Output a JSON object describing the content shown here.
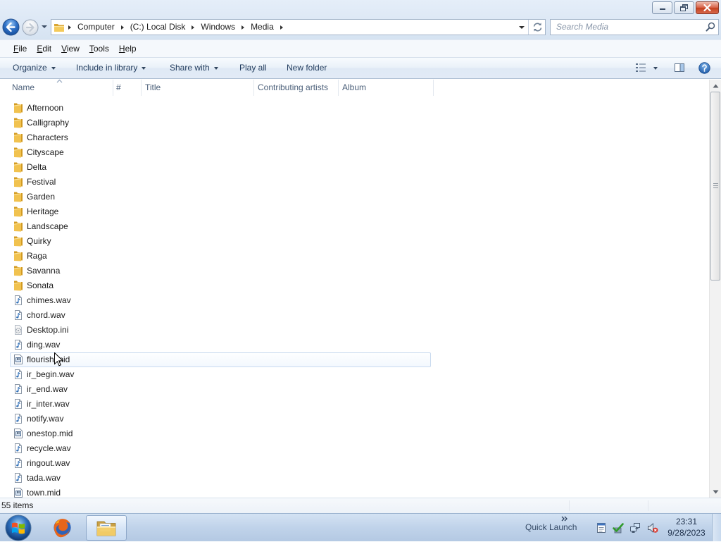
{
  "navigation": {
    "crumbs": [
      "Computer",
      "(C:) Local Disk",
      "Windows",
      "Media"
    ],
    "search_placeholder": "Search Media"
  },
  "menu": [
    "File",
    "Edit",
    "View",
    "Tools",
    "Help"
  ],
  "command_bar": {
    "organize": "Organize",
    "include_in_library": "Include in library",
    "share_with": "Share with",
    "play_all": "Play all",
    "new_folder": "New folder"
  },
  "columns": [
    "Name",
    "#",
    "Title",
    "Contributing artists",
    "Album"
  ],
  "sort": {
    "column": "Name",
    "direction": "ascending"
  },
  "files": [
    {
      "name": "Afternoon",
      "icon": "folder-icon"
    },
    {
      "name": "Calligraphy",
      "icon": "folder-icon"
    },
    {
      "name": "Characters",
      "icon": "folder-icon"
    },
    {
      "name": "Cityscape",
      "icon": "folder-icon"
    },
    {
      "name": "Delta",
      "icon": "folder-icon"
    },
    {
      "name": "Festival",
      "icon": "folder-icon"
    },
    {
      "name": "Garden",
      "icon": "folder-icon"
    },
    {
      "name": "Heritage",
      "icon": "folder-icon"
    },
    {
      "name": "Landscape",
      "icon": "folder-icon"
    },
    {
      "name": "Quirky",
      "icon": "folder-icon"
    },
    {
      "name": "Raga",
      "icon": "folder-icon"
    },
    {
      "name": "Savanna",
      "icon": "folder-icon"
    },
    {
      "name": "Sonata",
      "icon": "folder-icon"
    },
    {
      "name": "chimes.wav",
      "icon": "audio-file-icon"
    },
    {
      "name": "chord.wav",
      "icon": "audio-file-icon"
    },
    {
      "name": "Desktop.ini",
      "icon": "settings-file-icon"
    },
    {
      "name": "ding.wav",
      "icon": "audio-file-icon"
    },
    {
      "name": "flourish.mid",
      "icon": "midi-file-icon",
      "state": "hover"
    },
    {
      "name": "ir_begin.wav",
      "icon": "audio-file-icon"
    },
    {
      "name": "ir_end.wav",
      "icon": "audio-file-icon"
    },
    {
      "name": "ir_inter.wav",
      "icon": "audio-file-icon"
    },
    {
      "name": "notify.wav",
      "icon": "audio-file-icon"
    },
    {
      "name": "onestop.mid",
      "icon": "midi-file-icon"
    },
    {
      "name": "recycle.wav",
      "icon": "audio-file-icon"
    },
    {
      "name": "ringout.wav",
      "icon": "audio-file-icon"
    },
    {
      "name": "tada.wav",
      "icon": "audio-file-icon"
    },
    {
      "name": "town.mid",
      "icon": "midi-file-icon"
    }
  ],
  "status": {
    "item_count": "55 items"
  },
  "taskbar": {
    "pinned": [
      "start-orb-icon",
      "firefox-icon",
      "windows-explorer-icon"
    ],
    "active": "windows-explorer-icon",
    "quick_launch": "Quick Launch",
    "tray_icons": [
      "tray-document-icon",
      "security-check-icon",
      "network-icon",
      "volume-muted-icon"
    ],
    "time": "23:31",
    "date": "9/28/2023"
  },
  "colors": {
    "command_text": "#1e395b",
    "column_header_text": "#4c607a",
    "hover_border": "#c9daef",
    "close_button": "#c4411f",
    "taskbar": "#c0d3ea"
  }
}
